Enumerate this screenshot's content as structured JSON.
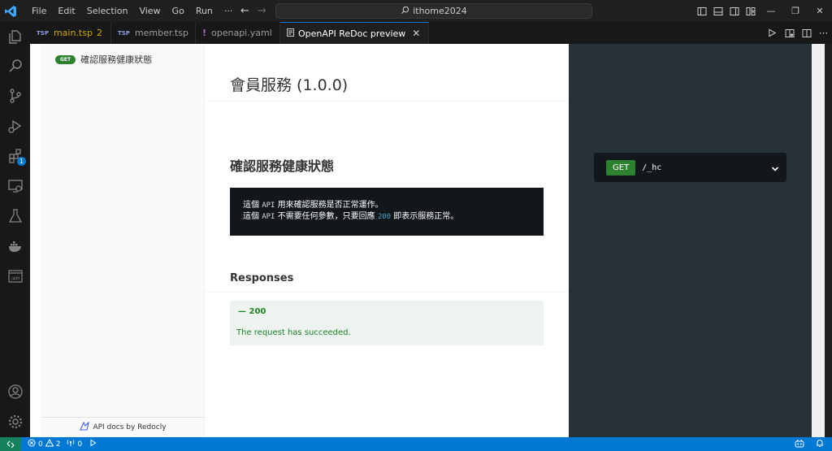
{
  "titlebar": {
    "menu": [
      "File",
      "Edit",
      "Selection",
      "View",
      "Go",
      "Run",
      "···"
    ],
    "search_text": "ithome2024"
  },
  "tabs": [
    {
      "label": "main.tsp",
      "icon": "tsp-file-icon",
      "badge": "2",
      "warning": true
    },
    {
      "label": "member.tsp",
      "icon": "tsp-file-icon"
    },
    {
      "label": "openapi.yaml",
      "icon": "yaml-file-icon"
    },
    {
      "label": "OpenAPI ReDoc preview",
      "icon": "preview-file-icon",
      "active": true
    }
  ],
  "activity_badges": {
    "extensions": "1"
  },
  "redoc": {
    "sidebar": {
      "items": [
        {
          "method": "GET",
          "label": "確認服務健康狀態"
        }
      ],
      "footer": "API docs by Redocly"
    },
    "api_title": "會員服務 (1.0.0)",
    "operation": {
      "title": "確認服務健康狀態",
      "desc_line1_a": "這個",
      "desc_line1_code": "API",
      "desc_line1_b": "用來確認服務是否正常運作。",
      "desc_line2_a": "這個",
      "desc_line2_code": "API",
      "desc_line2_b": "不需要任何參數，只要回應",
      "desc_line2_num": "200",
      "desc_line2_c": "即表示服務正常。",
      "responses_heading": "Responses",
      "response_code": "— 200",
      "response_desc": "The request has succeeded."
    },
    "endpoint": {
      "method": "GET",
      "path": "/_hc"
    }
  },
  "statusbar": {
    "errors": "0",
    "warnings": "2",
    "ports": "0"
  },
  "colors": {
    "accent": "#0078d4",
    "get_green": "#2f8132",
    "success_text": "#1d8127",
    "redoc_dark": "#263238"
  }
}
